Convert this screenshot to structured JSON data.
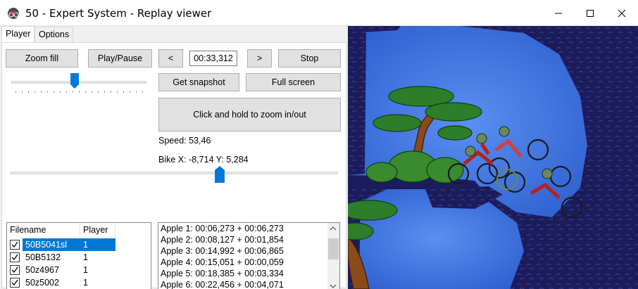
{
  "window": {
    "title": "50 - Expert System - Replay viewer",
    "icon": "elma-app-icon"
  },
  "tabs": [
    {
      "label": "Player",
      "active": true
    },
    {
      "label": "Options",
      "active": false
    }
  ],
  "controls": {
    "zoom_fill_label": "Zoom fill",
    "play_pause_label": "Play/Pause",
    "prev_label": "<",
    "time_value": "00:33,312",
    "next_label": ">",
    "stop_label": "Stop",
    "snapshot_label": "Get snapshot",
    "fullscreen_label": "Full screen",
    "zoom_hold_label": "Click and hold to zoom in/out",
    "zoom_slider_level": 0.47,
    "timeline_level": 0.64
  },
  "status": {
    "speed": "Speed: 53,46",
    "bike_pos": "Bike X: -8,714 Y: 5,284"
  },
  "file_list": {
    "columns": [
      "Filename",
      "Player"
    ],
    "rows": [
      {
        "checked": true,
        "filename": "50B5041sl",
        "player": "1",
        "selected": true
      },
      {
        "checked": true,
        "filename": "50B5132",
        "player": "1",
        "selected": false
      },
      {
        "checked": true,
        "filename": "50z4967",
        "player": "1",
        "selected": false
      },
      {
        "checked": true,
        "filename": "50z5002",
        "player": "1",
        "selected": false
      }
    ]
  },
  "apple_list": {
    "items": [
      "Apple 1: 00:06,273 + 00:06,273",
      "Apple 2: 00:08,127 + 00:01,854",
      "Apple 3: 00:14,992 + 00:06,865",
      "Apple 4: 00:15,051 + 00:00,059",
      "Apple 5: 00:18,385 + 00:03,334",
      "Apple 6: 00:22,456 + 00:04,071"
    ]
  },
  "colors": {
    "accent": "#0078d7",
    "sky": "#3a6fd8",
    "ground": "#1a1a5e",
    "tree_foliage": "#2e7d2a",
    "trunk": "#8a4a1a"
  }
}
